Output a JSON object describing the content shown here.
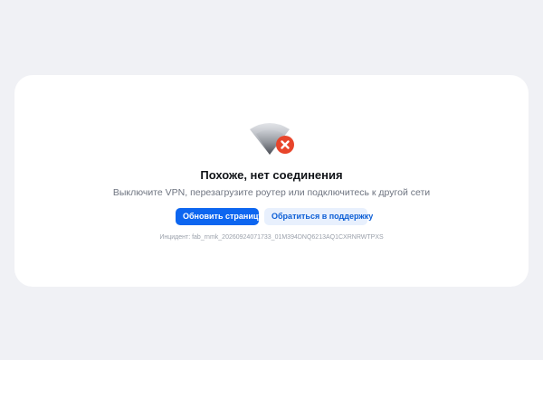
{
  "error": {
    "title": "Похоже, нет соединения",
    "subtitle": "Выключите VPN, перезагрузите роутер или подключитесь к другой сети",
    "incident": "Инцидент: fab_rnmk_20260924071733_01M394DNQ6213AQ1CXRNRWTPXS"
  },
  "actions": {
    "refresh_label": "Обновить страницу",
    "support_label": "Обратиться в поддержку"
  },
  "icons": {
    "main": "wifi-off-icon"
  },
  "colors": {
    "primary": "#0d66f0",
    "secondary_bg": "#e8f0fd",
    "error_badge": "#e8452b",
    "page_bg": "#f0f1f5"
  }
}
